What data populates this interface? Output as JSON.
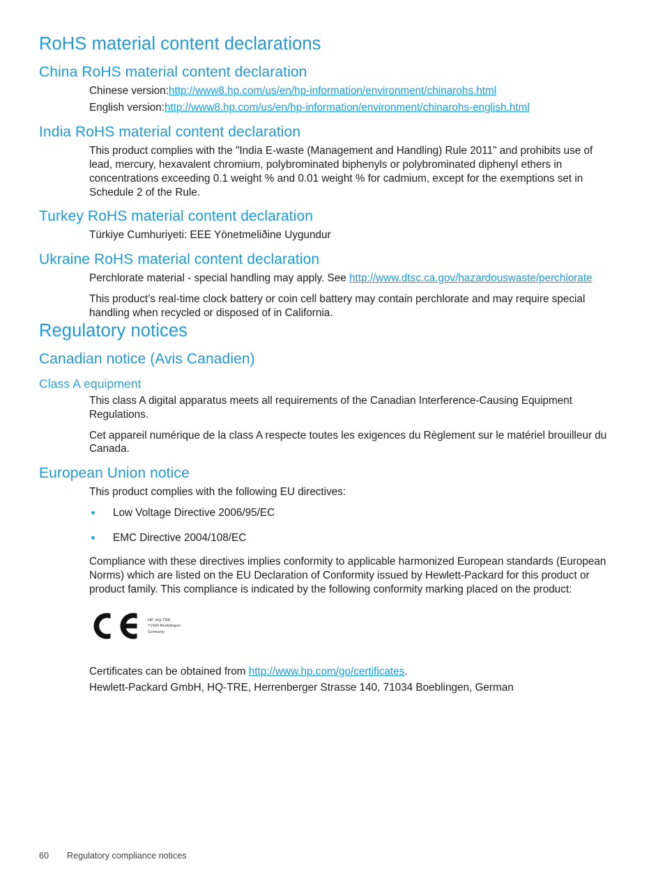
{
  "document": {
    "sections": [
      {
        "id": "rohs",
        "title": "RoHS material content declarations",
        "subsections": [
          {
            "id": "china-rohs",
            "title": "China RoHS material content declaration",
            "lines": [
              {
                "label": "Chinese version:",
                "link": "http://www8.hp.com/us/en/hp-information/environment/chinarohs.html"
              },
              {
                "label": "English version:",
                "link": "http://www8.hp.com/us/en/hp-information/environment/chinarohs-english.html"
              }
            ]
          },
          {
            "id": "india-rohs",
            "title": "India RoHS material content declaration",
            "body": "This product complies with the \"India E-waste (Management and Handling) Rule 2011\" and prohibits use of lead, mercury, hexavalent chromium, polybrominated biphenyls or polybrominated diphenyl ethers in concentrations exceeding 0.1 weight % and 0.01 weight % for cadmium, except for the exemptions set in Schedule 2 of the Rule."
          },
          {
            "id": "turkey-rohs",
            "title": "Turkey RoHS material content declaration",
            "body": "Türkiye Cumhuriyeti: EEE Yönetmeliðine Uygundur"
          },
          {
            "id": "ukraine-rohs",
            "title": "Ukraine RoHS material content declaration",
            "para1_before": "Perchlorate material - special handling may apply. See ",
            "para1_link": "http://www.dtsc.ca.gov/hazardouswaste/perchlorate",
            "para2": "This product’s real-time clock battery or coin cell battery may contain perchlorate and may require special handling when recycled or disposed of in California."
          }
        ]
      },
      {
        "id": "regulatory",
        "title": "Regulatory notices",
        "subsections": [
          {
            "id": "canadian-notice",
            "title": "Canadian notice (Avis Canadien)",
            "subsubsection": {
              "id": "class-a-equipment",
              "title": "Class A equipment",
              "para1": "This class A digital apparatus meets all requirements of the Canadian Interference-Causing Equipment Regulations.",
              "para2": "Cet appareil numérique de la class A respecte toutes les exigences du Règlement sur le matériel brouilleur du Canada."
            }
          },
          {
            "id": "eu-notice",
            "title": "European Union notice",
            "intro": "This product complies with the following EU directives:",
            "bullets": [
              "Low Voltage Directive 2006/95/EC",
              "EMC Directive 2004/108/EC"
            ],
            "compliance_para": "Compliance with these directives implies conformity to applicable harmonized European standards (European Norms) which are listed on the EU Declaration of Conformity issued by Hewlett-Packard for this product or product family. This compliance is indicated by the following conformity marking placed on the product:",
            "ce_mark": {
              "icon": "ce-marking",
              "address_lines": [
                "HP, HQ-TRE",
                "71004 Boeblingen",
                "Germany"
              ]
            },
            "certificates_before": "Certificates can be obtained from ",
            "certificates_link": "http://www.hp.com/go/certificates",
            "certificates_after": ".",
            "address_line": "Hewlett-Packard GmbH, HQ-TRE, Herrenberger Strasse 140, 71034 Boeblingen, German"
          }
        ]
      }
    ]
  },
  "footer": {
    "page_number": "60",
    "chapter_title": "Regulatory compliance notices"
  },
  "colors": {
    "heading_blue": "#1b9ad6",
    "subheading_blue": "#2aa3da",
    "link_blue": "#1b9ad6",
    "body_text": "#1a1a1a",
    "footer_text": "#404040",
    "page_background": "#ffffff"
  }
}
